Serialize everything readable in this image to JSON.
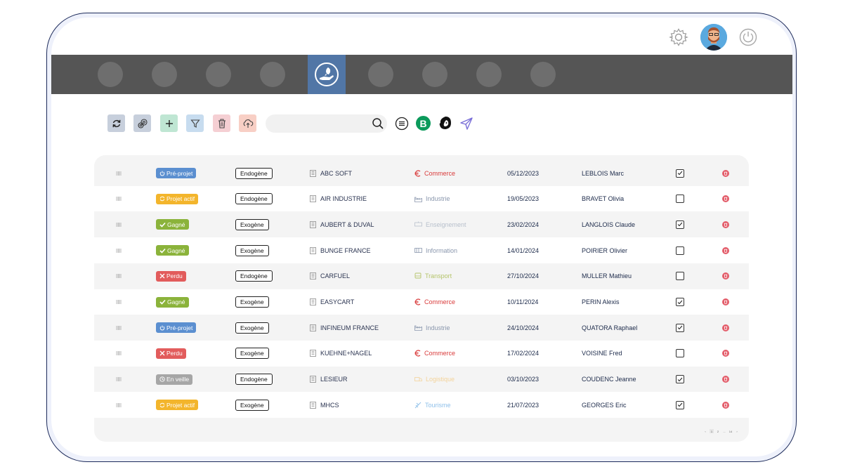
{
  "header": {
    "icons": [
      "gear-icon",
      "avatar",
      "power-icon"
    ]
  },
  "nav": {
    "items": [
      "nav-dot",
      "nav-dot",
      "nav-dot",
      "nav-dot",
      "hand-rocket-icon",
      "nav-dot",
      "nav-dot",
      "nav-dot",
      "nav-dot"
    ],
    "active_index": 4
  },
  "toolbar": {
    "buttons": [
      {
        "icon": "refresh-icon",
        "color": "#c7cfdc"
      },
      {
        "icon": "settings-cluster-icon",
        "color": "#c7cfdc"
      },
      {
        "icon": "plus-icon",
        "color": "#bfe6d3"
      },
      {
        "icon": "filter-icon",
        "color": "#c7dcef"
      },
      {
        "icon": "trash-icon",
        "color": "#f5cfd3"
      },
      {
        "icon": "cloud-upload-icon",
        "color": "#f8cfc5"
      }
    ],
    "search": {
      "value": "",
      "placeholder": ""
    },
    "extra_icons": [
      "list-icon",
      "b-logo-icon",
      "mailchimp-icon",
      "send-icon"
    ]
  },
  "status_colors": {
    "Pré-projet": "#5b8fd0",
    "Projet actif": "#f3b52c",
    "Gagné": "#8bb33b",
    "Perdu": "#e25c5c",
    "En veille": "#a6a6a6"
  },
  "sector_colors": {
    "Commerce": "#d93b3b",
    "Industrie": "#8a97ad",
    "Enseignement": "#b8c0cc",
    "Information": "#8a97ad",
    "Transport": "#b5c46a",
    "Logistique": "#f3d39a",
    "Tourisme": "#8fc0ea"
  },
  "rows": [
    {
      "status": "Pré-projet",
      "status_icon": "power-icon",
      "origin": "Endogène",
      "company": "ABC SOFT",
      "sector": "Commerce",
      "sector_icon": "euro-icon",
      "date": "05/12/2023",
      "contact": "LEBLOIS Marc",
      "checked": true
    },
    {
      "status": "Projet actif",
      "status_icon": "refresh-icon",
      "origin": "Endogène",
      "company": "AIR INDUSTRIE",
      "sector": "Industrie",
      "sector_icon": "factory-icon",
      "date": "19/05/2023",
      "contact": "BRAVET Olivia",
      "checked": false
    },
    {
      "status": "Gagné",
      "status_icon": "check-icon",
      "origin": "Exogène",
      "company": "AUBERT & DUVAL",
      "sector": "Enseignement",
      "sector_icon": "board-icon",
      "date": "23/02/2024",
      "contact": "LANGLOIS Claude",
      "checked": true
    },
    {
      "status": "Gagné",
      "status_icon": "check-icon",
      "origin": "Exogène",
      "company": "BUNGE FRANCE",
      "sector": "Information",
      "sector_icon": "info-icon",
      "date": "14/01/2024",
      "contact": "POIRIER Olivier",
      "checked": false
    },
    {
      "status": "Perdu",
      "status_icon": "close-icon",
      "origin": "Endogène",
      "company": "CARFUEL",
      "sector": "Transport",
      "sector_icon": "bus-icon",
      "date": "27/10/2024",
      "contact": "MULLER Mathieu",
      "checked": false
    },
    {
      "status": "Gagné",
      "status_icon": "check-icon",
      "origin": "Exogène",
      "company": "EASYCART",
      "sector": "Commerce",
      "sector_icon": "euro-icon",
      "date": "10/11/2024",
      "contact": "PERIN Alexis",
      "checked": true
    },
    {
      "status": "Pré-projet",
      "status_icon": "power-icon",
      "origin": "Exogène",
      "company": "INFINEUM FRANCE",
      "sector": "Industrie",
      "sector_icon": "factory-icon",
      "date": "24/10/2024",
      "contact": "QUATORA Raphael",
      "checked": true
    },
    {
      "status": "Perdu",
      "status_icon": "close-icon",
      "origin": "Exogène",
      "company": "KUEHNE+NAGEL",
      "sector": "Commerce",
      "sector_icon": "euro-icon",
      "date": "17/02/2024",
      "contact": "VOISINE Fred",
      "checked": false
    },
    {
      "status": "En veille",
      "status_icon": "clock-icon",
      "origin": "Endogène",
      "company": "LESIEUR",
      "sector": "Logistique",
      "sector_icon": "truck-icon",
      "date": "03/10/2023",
      "contact": "COUDENC Jeanne",
      "checked": true
    },
    {
      "status": "Projet actif",
      "status_icon": "refresh-icon",
      "origin": "Exogène",
      "company": "MHCS",
      "sector": "Tourisme",
      "sector_icon": "plane-icon",
      "date": "21/07/2023",
      "contact": "GEORGES Eric",
      "checked": true
    }
  ],
  "pagination": [
    "‹",
    "1",
    "2",
    "...",
    "14",
    "›"
  ],
  "pagination_current": "1"
}
